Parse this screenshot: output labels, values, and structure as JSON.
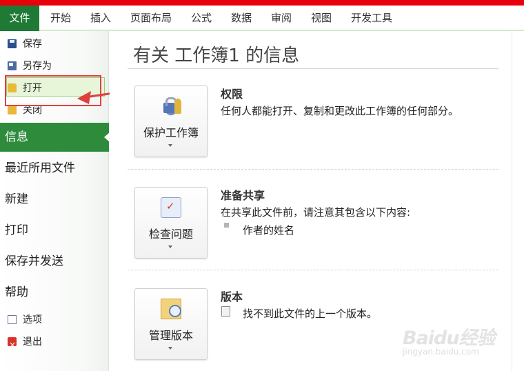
{
  "ribbon": {
    "file_tab": "文件",
    "tabs": [
      "开始",
      "插入",
      "页面布局",
      "公式",
      "数据",
      "审阅",
      "视图",
      "开发工具"
    ]
  },
  "left_panel": {
    "commands_top": [
      {
        "label": "保存",
        "icon": "save-icon"
      },
      {
        "label": "另存为",
        "icon": "save-as-icon"
      },
      {
        "label": "打开",
        "icon": "open-folder-icon"
      },
      {
        "label": "关闭",
        "icon": "close-folder-icon"
      }
    ],
    "sections": [
      {
        "label": "信息",
        "active": true
      },
      {
        "label": "最近所用文件"
      },
      {
        "label": "新建"
      },
      {
        "label": "打印"
      },
      {
        "label": "保存并发送"
      },
      {
        "label": "帮助"
      }
    ],
    "commands_bottom": [
      {
        "label": "选项",
        "icon": "options-icon"
      },
      {
        "label": "退出",
        "icon": "exit-icon"
      }
    ]
  },
  "main": {
    "title": "有关 工作簿1 的信息",
    "sections": [
      {
        "button": "保护工作簿",
        "icon": "lock-key-icon",
        "heading": "权限",
        "desc": "任何人都能打开、复制和更改此工作簿的任何部分。"
      },
      {
        "button": "检查问题",
        "icon": "inspect-icon",
        "heading": "准备共享",
        "desc": "在共享此文件前，请注意其包含以下内容:",
        "items": [
          "作者的姓名"
        ]
      },
      {
        "button": "管理版本",
        "icon": "versions-icon",
        "heading": "版本",
        "desc": "找不到此文件的上一个版本。"
      }
    ]
  },
  "watermark": {
    "brand": "Baidu经验",
    "url": "jingyan.baidu.com"
  },
  "colors": {
    "file_tab": "#1f7a36",
    "active_section": "#2f8b3c",
    "annotation": "#e0403c",
    "top_bar": "#e8000b"
  }
}
